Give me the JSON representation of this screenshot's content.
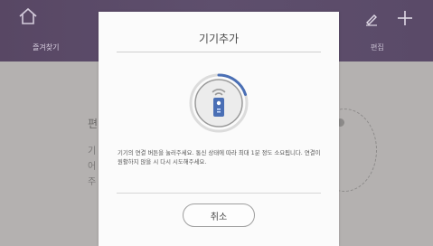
{
  "background": {
    "tabs": {
      "favorites": "즐겨찾기",
      "edit": "편집"
    },
    "heading": "편",
    "lines": [
      "기",
      "어",
      "주"
    ]
  },
  "dialog": {
    "title": "기기추가",
    "message": "기기의 연결 버튼을 눌러주세요. 통신 상태에 따라 최대 1분 정도 소요됩니다. 연결이 원활하지 않을 시 다시 시도해주세요.",
    "cancel_label": "취소",
    "progress": 0.2
  },
  "colors": {
    "topbar": "#5e4f6d",
    "accent": "#4a6fb5",
    "dialog_bg": "#fbfbfb"
  },
  "icons": [
    "home-icon",
    "pencil-icon",
    "plus-icon",
    "remote-device-icon",
    "signal-icon"
  ]
}
